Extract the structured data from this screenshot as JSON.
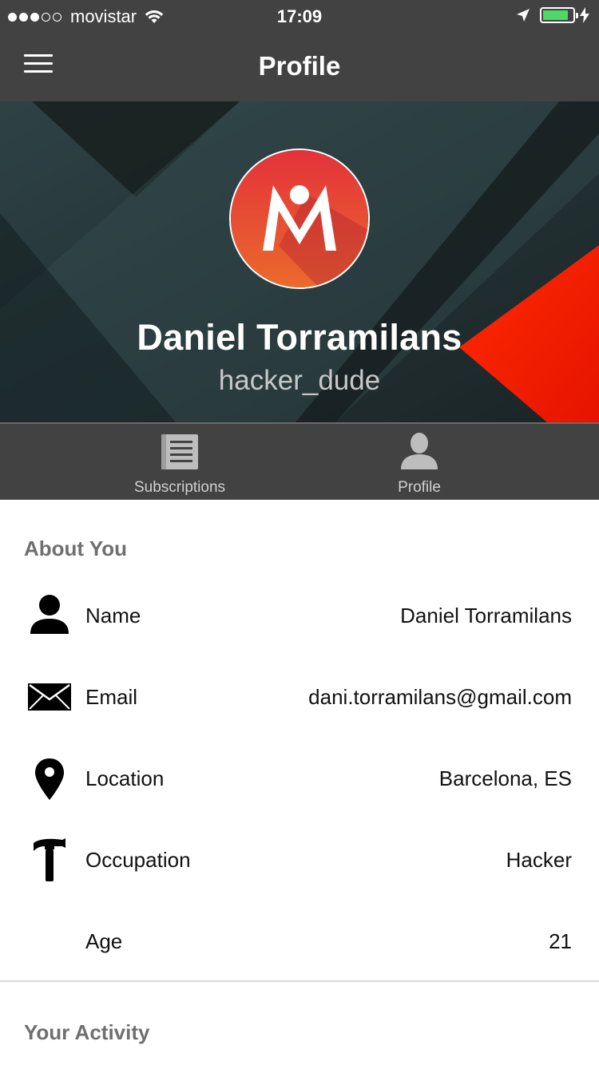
{
  "status_bar": {
    "carrier": "movistar",
    "time": "17:09",
    "signal_bars_filled": 3,
    "signal_bars_total": 5,
    "battery_level": 0.85,
    "icons": [
      "wifi-icon",
      "location-arrow-icon",
      "battery-icon",
      "charging-bolt-icon"
    ]
  },
  "nav": {
    "title": "Profile",
    "menu_icon": "hamburger-menu-icon"
  },
  "header": {
    "name": "Daniel Torramilans",
    "username": "hacker_dude",
    "avatar_letter": "M",
    "colors": {
      "avatar_top": "#e4323a",
      "avatar_bottom": "#ea6a2c",
      "accent_triangle": "#ff1d00"
    }
  },
  "tabs": [
    {
      "label": "Subscriptions",
      "icon": "newspaper-icon"
    },
    {
      "label": "Profile",
      "icon": "person-icon"
    }
  ],
  "about": {
    "title": "About You",
    "rows": [
      {
        "icon": "person-icon",
        "label": "Name",
        "value": "Daniel Torramilans"
      },
      {
        "icon": "envelope-icon",
        "label": "Email",
        "value": "dani.torramilans@gmail.com"
      },
      {
        "icon": "map-pin-icon",
        "label": "Location",
        "value": "Barcelona, ES"
      },
      {
        "icon": "hammer-icon",
        "label": "Occupation",
        "value": "Hacker"
      },
      {
        "icon": "",
        "label": "Age",
        "value": "21"
      }
    ]
  },
  "activity": {
    "title": "Your Activity"
  }
}
